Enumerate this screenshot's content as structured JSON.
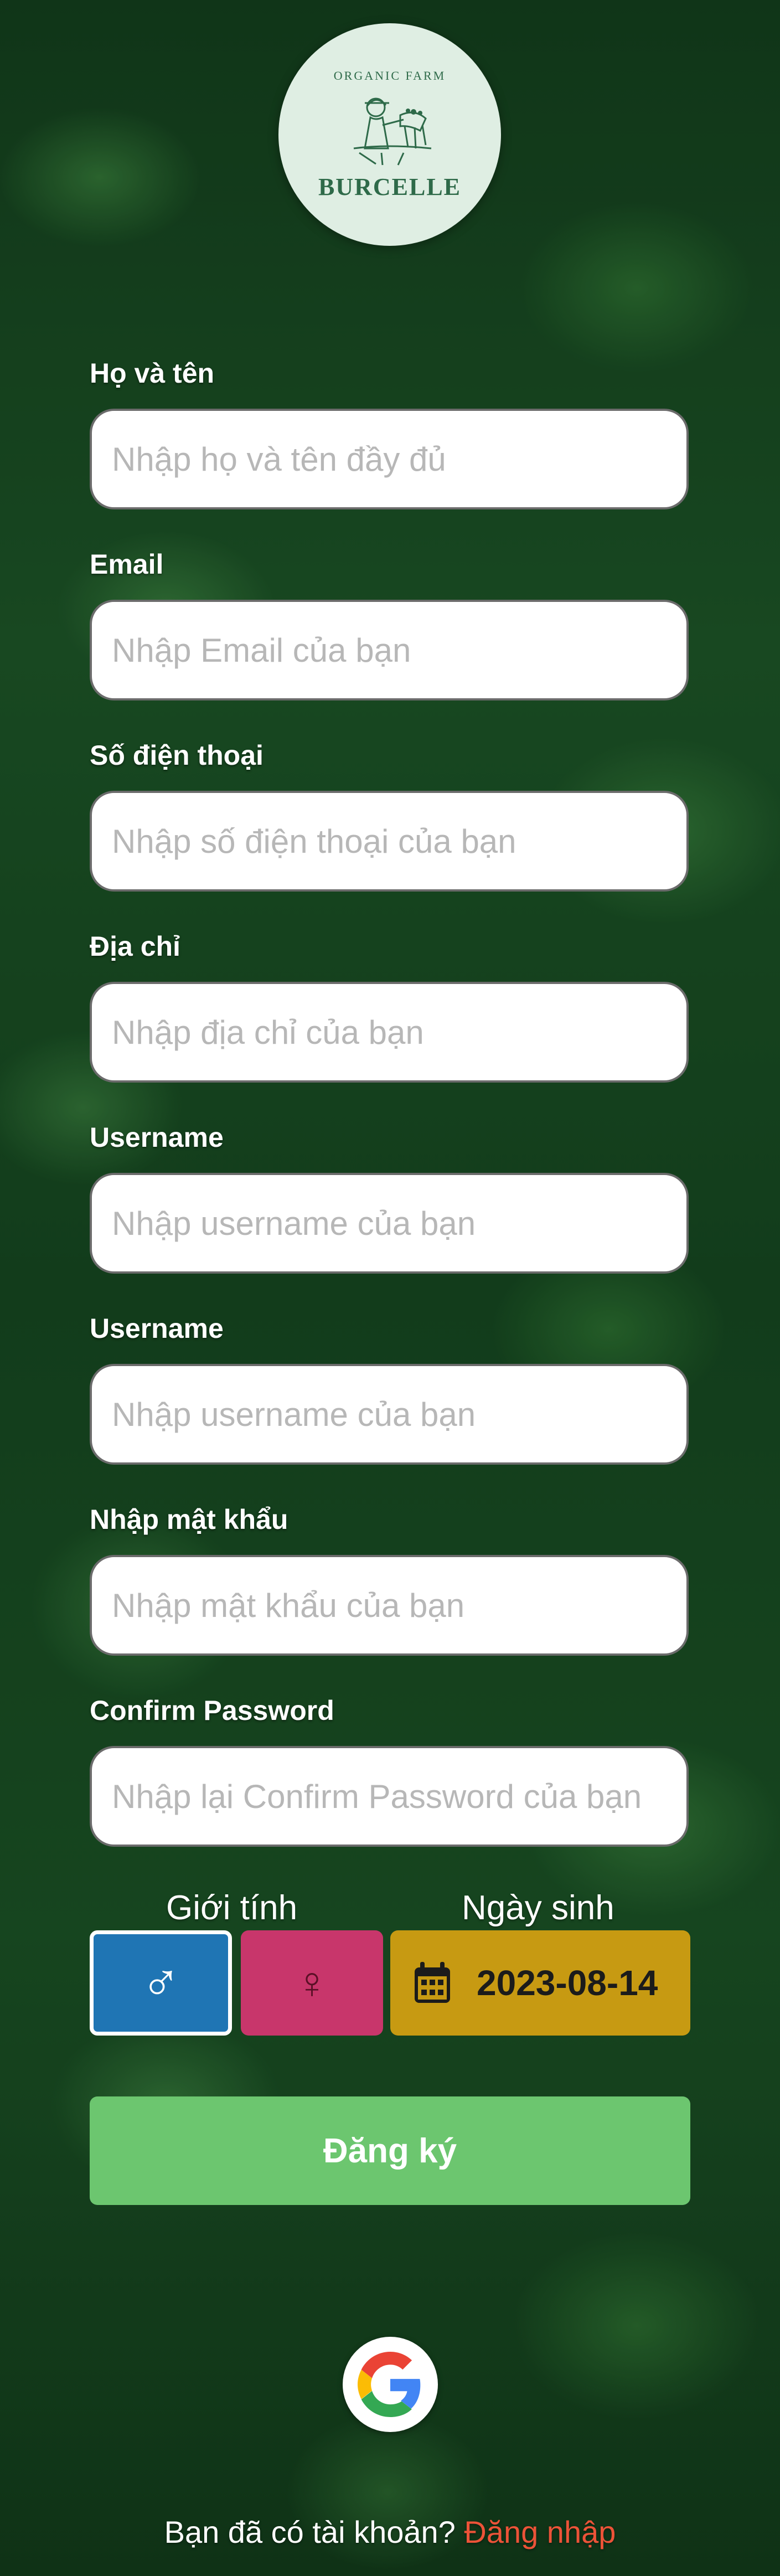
{
  "logo": {
    "arc_text": "ORGANIC FARM",
    "brand": "BURCELLE"
  },
  "form": {
    "fields": [
      {
        "label": "Họ và tên",
        "placeholder": "Nhập họ và tên đầy đủ",
        "value": ""
      },
      {
        "label": "Email",
        "placeholder": "Nhập Email của bạn",
        "value": ""
      },
      {
        "label": "Số điện thoại",
        "placeholder": "Nhập số điện thoại của bạn",
        "value": ""
      },
      {
        "label": "Địa chỉ",
        "placeholder": "Nhập địa chỉ của bạn",
        "value": ""
      },
      {
        "label": "Username",
        "placeholder": "Nhập username của bạn",
        "value": ""
      },
      {
        "label": "Username",
        "placeholder": "Nhập username của bạn",
        "value": ""
      },
      {
        "label": "Nhập mật khẩu",
        "placeholder": "Nhập mật khẩu của bạn",
        "value": ""
      },
      {
        "label": "Confirm Password",
        "placeholder": "Nhập lại Confirm Password của bạn",
        "value": ""
      }
    ],
    "gender_label": "Giới tính",
    "birthday_label": "Ngày sinh",
    "gender": {
      "selected": "male",
      "male_icon": "male-symbol-icon",
      "female_icon": "female-symbol-icon",
      "male_color": "#1f75b4",
      "female_color": "#c8366b"
    },
    "birthday": {
      "value": "2023-08-14",
      "icon": "calendar-icon",
      "color": "#c79a12"
    },
    "submit_label": "Đăng ký",
    "submit_color": "#6cc66f"
  },
  "social": {
    "google_icon": "google-icon"
  },
  "footer": {
    "question": "Bạn đã có tài khoản?",
    "login_link": "Đăng nhập",
    "link_color": "#ec5338"
  }
}
